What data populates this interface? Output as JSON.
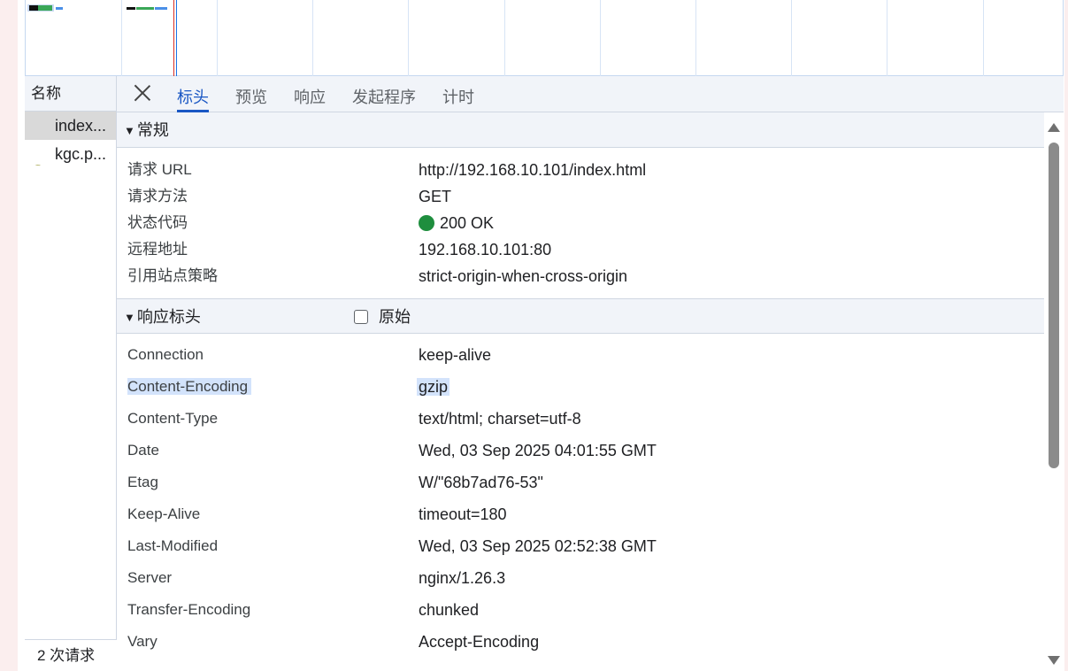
{
  "list": {
    "header": "名称",
    "items": [
      {
        "label": "index..."
      },
      {
        "label": "kgc.p..."
      }
    ],
    "footer": "2 次请求  "
  },
  "tabs": [
    {
      "label": "标头"
    },
    {
      "label": "预览"
    },
    {
      "label": "响应"
    },
    {
      "label": "发起程序"
    },
    {
      "label": "计时"
    }
  ],
  "general": {
    "title": "常规",
    "rows": [
      {
        "key": "请求 URL",
        "value": "http://192.168.10.101/index.html"
      },
      {
        "key": "请求方法",
        "value": "GET"
      },
      {
        "key": "状态代码",
        "value": "200 OK"
      },
      {
        "key": "远程地址",
        "value": "192.168.10.101:80"
      },
      {
        "key": "引用站点策略",
        "value": "strict-origin-when-cross-origin"
      }
    ]
  },
  "response_headers": {
    "title": "响应标头",
    "raw_label": "原始",
    "rows": [
      {
        "key": "Connection",
        "value": "keep-alive"
      },
      {
        "key": "Content-Encoding",
        "value": "gzip"
      },
      {
        "key": "Content-Type",
        "value": "text/html; charset=utf-8"
      },
      {
        "key": "Date",
        "value": "Wed, 03 Sep 2025 04:01:55 GMT"
      },
      {
        "key": "Etag",
        "value": "W/\"68b7ad76-53\""
      },
      {
        "key": "Keep-Alive",
        "value": "timeout=180"
      },
      {
        "key": "Last-Modified",
        "value": "Wed, 03 Sep 2025 02:52:38 GMT"
      },
      {
        "key": "Server",
        "value": "nginx/1.26.3"
      },
      {
        "key": "Transfer-Encoding",
        "value": "chunked"
      },
      {
        "key": "Vary",
        "value": "Accept-Encoding"
      }
    ]
  },
  "colors": {
    "accent": "#1a57c4",
    "status_ok": "#1e8e3e",
    "highlight": "#d3e3fb"
  },
  "icons": {
    "close": "close-icon",
    "collapse": "triangle-down-icon",
    "scroll_up": "arrow-up-icon",
    "scroll_down": "arrow-down-icon"
  }
}
